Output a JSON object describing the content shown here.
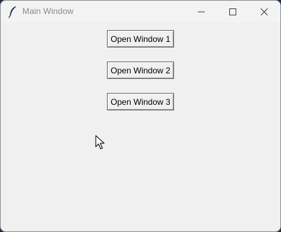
{
  "window": {
    "title": "Main Window",
    "icon": "feather-icon"
  },
  "title_controls": {
    "minimize_icon": "minimize-icon",
    "maximize_icon": "maximize-icon",
    "close_icon": "close-icon"
  },
  "buttons": [
    {
      "label": "Open Window 1"
    },
    {
      "label": "Open Window 2"
    },
    {
      "label": "Open Window 3"
    }
  ],
  "cursor": {
    "icon": "mouse-pointer-icon"
  }
}
